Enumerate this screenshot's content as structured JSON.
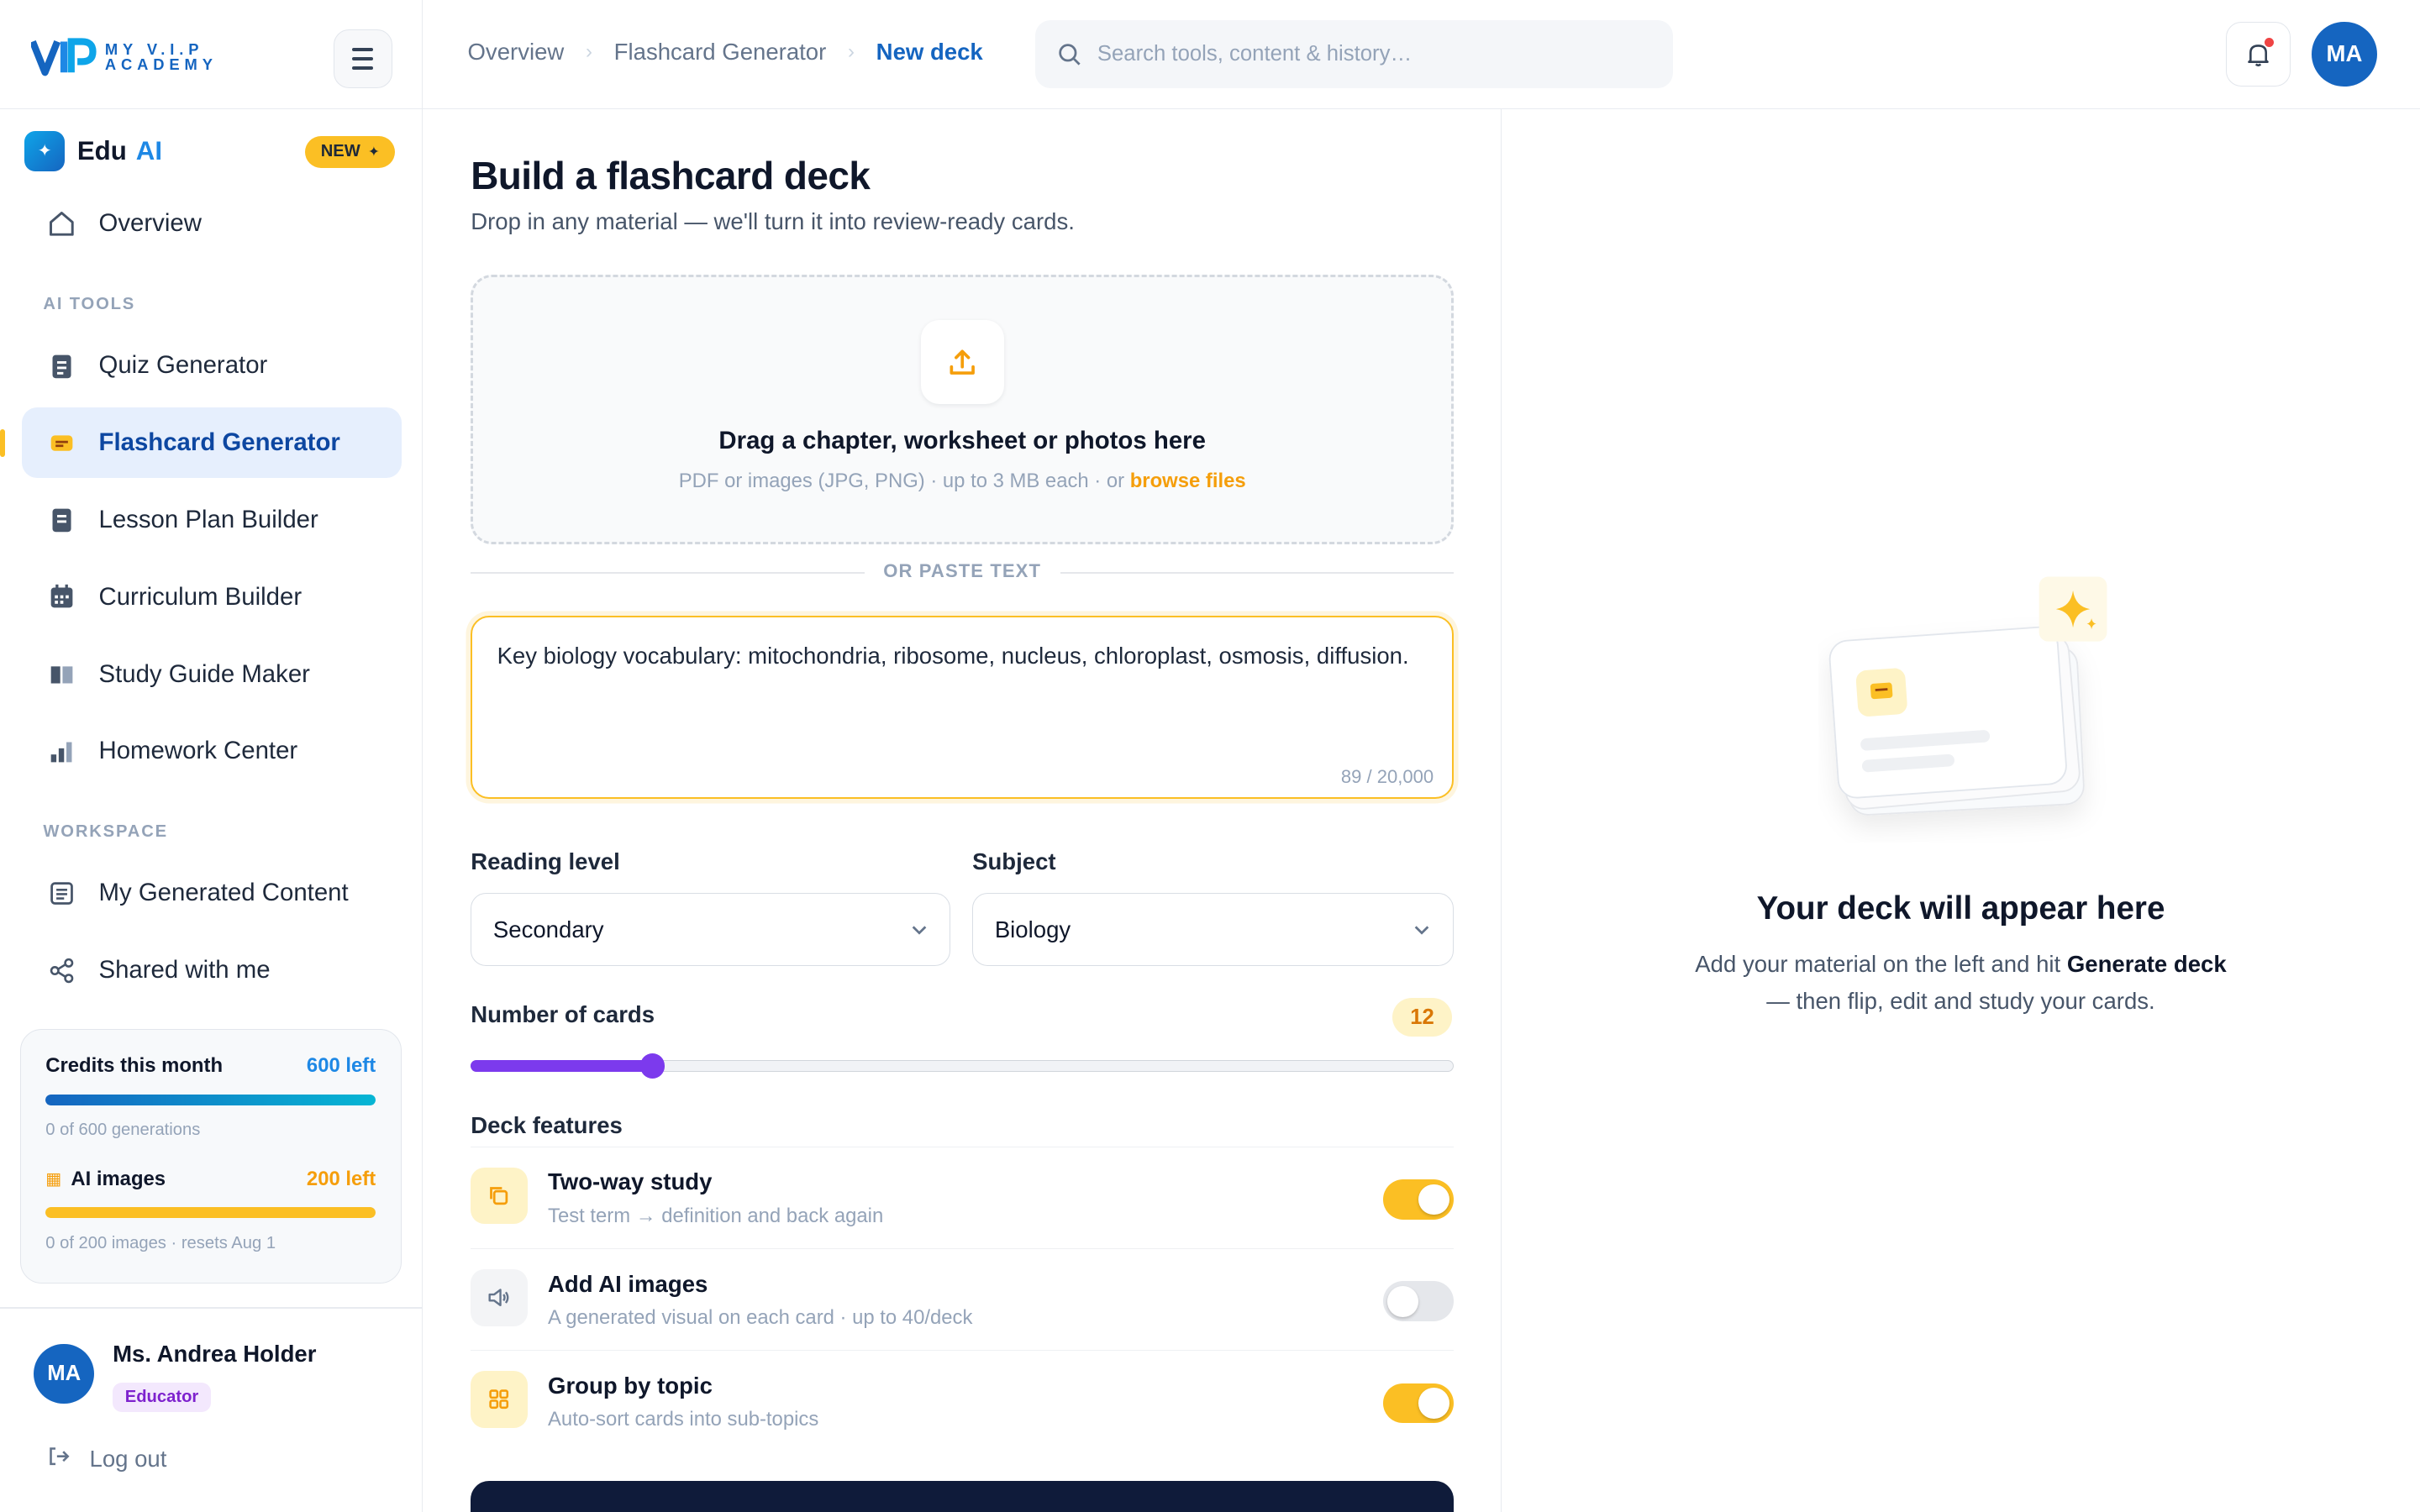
{
  "brand": {
    "line1": "MY V.I.P",
    "line2": "ACADEMY"
  },
  "edu_ai": {
    "name": "Edu",
    "ai": "AI",
    "badge": "NEW"
  },
  "nav": {
    "overview": "Overview",
    "section_ai_tools": "AI TOOLS",
    "items": [
      {
        "label": "Quiz Generator",
        "icon": "quiz-icon"
      },
      {
        "label": "Flashcard Generator",
        "icon": "flashcard-icon",
        "active": true
      },
      {
        "label": "Lesson Plan Builder",
        "icon": "lesson-plan-icon"
      },
      {
        "label": "Curriculum Builder",
        "icon": "calendar-icon"
      },
      {
        "label": "Study Guide Maker",
        "icon": "book-icon"
      },
      {
        "label": "Homework Center",
        "icon": "chart-icon"
      }
    ],
    "section_workspace": "WORKSPACE",
    "workspace": [
      {
        "label": "My Generated Content",
        "icon": "document-icon"
      },
      {
        "label": "Shared with me",
        "icon": "share-icon"
      }
    ]
  },
  "credits": {
    "title": "Credits this month",
    "left": "600 left",
    "generations": "0 of 600 generations",
    "generations_fill": 1.0,
    "images_title": "AI images",
    "images_left": "200 left",
    "images_sub": "0 of 200 images · resets Aug 1",
    "images_fill": 1.0
  },
  "user": {
    "initials": "MA",
    "name": "Ms. Andrea Holder",
    "role": "Educator",
    "logout": "Log out"
  },
  "breadcrumbs": [
    "Overview",
    "Flashcard Generator",
    "New deck"
  ],
  "search": {
    "placeholder": "Search tools, content & history…"
  },
  "topbar": {
    "avatar": "MA"
  },
  "form": {
    "title": "Build a flashcard deck",
    "subtitle": "Drop in any material — we'll turn it into review-ready cards.",
    "dropzone_title": "Drag a chapter, worksheet or photos here",
    "dropzone_sub": "PDF or images (JPG, PNG) · up to 3 MB each · or ",
    "dropzone_browse": "browse files",
    "or_paste": "OR PASTE TEXT",
    "text_value": "Key biology vocabulary: mitochondria, ribosome, nucleus, chloroplast, osmosis, diffusion.",
    "char_count": "89 / 20,000",
    "reading_level_label": "Reading level",
    "reading_level_value": "Secondary",
    "subject_label": "Subject",
    "subject_value": "Biology",
    "cards_label": "Number of cards",
    "cards_value": "12",
    "cards_slider_fraction": 0.185,
    "features_label": "Deck features",
    "features": [
      {
        "title": "Two-way study",
        "sub": "Test term → definition and back again",
        "on": true,
        "icon": "copy-icon",
        "icon_color": "#f59e0b",
        "icon_bg": "#fef3c7"
      },
      {
        "title": "Add AI images",
        "sub": "A generated visual on each card · up to 40/deck",
        "on": false,
        "icon": "speaker-icon",
        "icon_color": "#64748b",
        "icon_bg": "#f3f4f6"
      },
      {
        "title": "Group by topic",
        "sub": "Auto-sort cards into sub-topics",
        "on": true,
        "icon": "grid-icon",
        "icon_color": "#f59e0b",
        "icon_bg": "#fef3c7"
      }
    ]
  },
  "preview": {
    "title": "Your deck will appear here",
    "sub_pre": "Add your material on the left and hit ",
    "sub_bold": "Generate deck",
    "sub_post": " — then flip, edit and study your cards."
  },
  "colors": {
    "primary": "#1565c0",
    "accent": "#fbbf24",
    "slider": "#7c3aed",
    "dark_button": "#0f1b3a"
  }
}
